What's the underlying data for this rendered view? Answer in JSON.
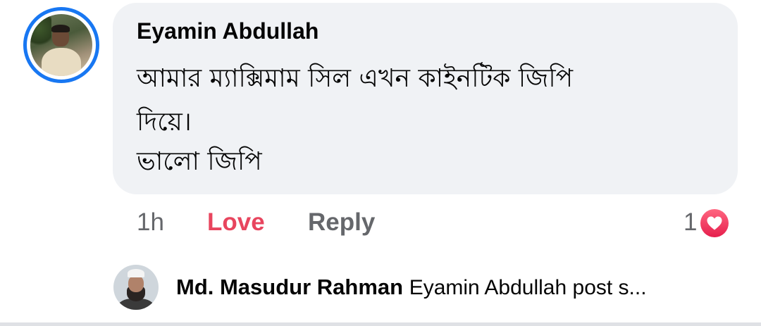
{
  "comment": {
    "author": "Eyamin Abdullah",
    "lines": [
      "আমার ম্যাক্সিমাম সিল এখন কাইনটিক জিপি",
      "দিয়ে।",
      "ভালো জিপি"
    ],
    "time": "1h",
    "reaction_label": "Love",
    "reply_label": "Reply",
    "reaction_count": "1",
    "reaction_icon": "heart-icon",
    "accent_color": "#1877f2",
    "love_color": "#e8455e"
  },
  "reply_preview": {
    "author": "Md. Masudur Rahman",
    "snippet": "Eyamin Abdullah post s..."
  }
}
